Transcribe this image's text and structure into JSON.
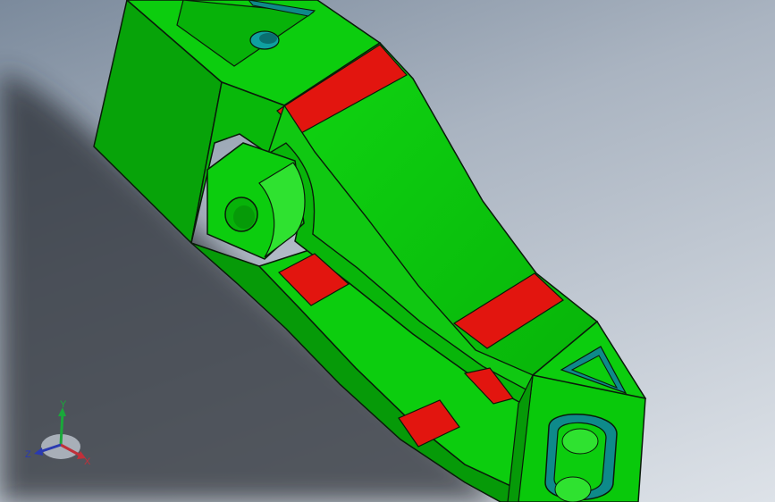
{
  "viewport": {
    "background_top": "#7b8a9c",
    "background_bottom": "#dde2e8"
  },
  "model": {
    "colors": {
      "body": "#09c90b",
      "body_shade": "#069a08",
      "body_light": "#2fe230",
      "edge": "#0a1a0a",
      "highlight_band": "#e2150f",
      "hole_interior": "#0e8a8a",
      "shadow": "#2b2f35"
    }
  },
  "triad": {
    "x_label": "X",
    "y_label": "Y",
    "z_label": "Z",
    "x_color": "#c0303a",
    "y_color": "#1aa83a",
    "z_color": "#2a3ab0"
  }
}
